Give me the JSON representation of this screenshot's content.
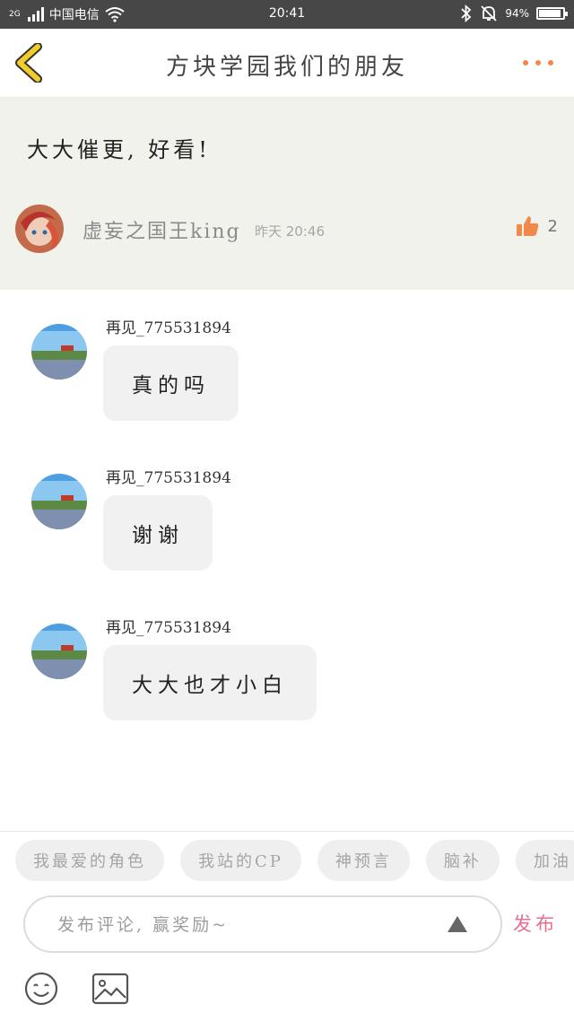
{
  "status_bar": {
    "network": "2G",
    "carrier": "中国电信",
    "time": "20:41",
    "battery": "94%",
    "battery_level": 0.94,
    "icons": [
      "signal-icon",
      "wifi-icon",
      "bluetooth-icon",
      "mute-bell-icon",
      "battery-icon"
    ]
  },
  "header": {
    "title": "方块学园我们的朋友",
    "back_icon": "chevron-left-icon",
    "more_icon": "more-dots-icon"
  },
  "main_comment": {
    "text": "大大催更, 好看!",
    "author": "虚妄之国王king",
    "time": "昨天 20:46",
    "likes": "2",
    "like_icon": "thumbs-up-icon"
  },
  "replies": [
    {
      "name": "再见_775531894",
      "text": "真的吗"
    },
    {
      "name": "再见_775531894",
      "text": "谢谢"
    },
    {
      "name": "再见_775531894",
      "text": "大大也才小白"
    }
  ],
  "tags": [
    "我最爱的角色",
    "我站的CP",
    "神预言",
    "脑补",
    "加油"
  ],
  "input": {
    "placeholder": "发布评论, 赢奖励~",
    "value": "",
    "send_icon": "triangle-up-icon"
  },
  "publish_label": "发布",
  "toolbar": {
    "emoji_icon": "emoji-icon",
    "image_icon": "image-icon"
  },
  "colors": {
    "accent_orange": "#f08a4b",
    "publish_pink": "#e96d8f",
    "back_yellow": "#f2cc2b",
    "main_bg": "#f1f2ec"
  }
}
